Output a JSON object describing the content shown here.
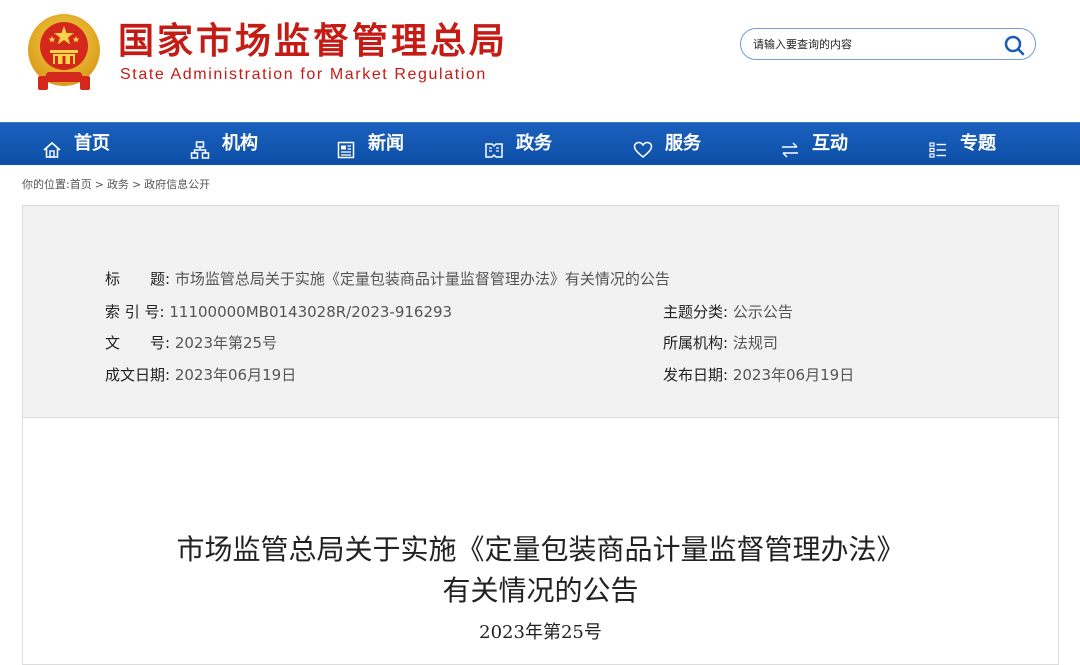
{
  "header": {
    "title_cn": "国家市场监督管理总局",
    "title_en": "State Administration for Market Regulation",
    "logo_icon": "national-emblem-icon",
    "brand_color": "#c41b14"
  },
  "search": {
    "placeholder": "请输入要查询的内容",
    "icon": "search-icon"
  },
  "nav": {
    "bg_color": "#1558b4",
    "items": [
      {
        "label": "首页",
        "icon": "home-icon"
      },
      {
        "label": "机构",
        "icon": "org-chart-icon"
      },
      {
        "label": "新闻",
        "icon": "news-icon"
      },
      {
        "label": "政务",
        "icon": "government-affairs-icon"
      },
      {
        "label": "服务",
        "icon": "heart-icon"
      },
      {
        "label": "互动",
        "icon": "exchange-icon"
      },
      {
        "label": "专题",
        "icon": "list-icon"
      }
    ]
  },
  "breadcrumb": {
    "prefix": "你的位置:",
    "items": [
      "首页",
      "政务",
      "政府信息公开"
    ],
    "separator": ">"
  },
  "info": {
    "title_label": "标　　题:",
    "title_value": "市场监管总局关于实施《定量包装商品计量监督管理办法》有关情况的公告",
    "index_label": "索 引 号:",
    "index_value": "11100000MB0143028R/2023-916293",
    "topic_label": "主题分类:",
    "topic_value": "公示公告",
    "docno_label": "文　　号:",
    "docno_value": "2023年第25号",
    "org_label": "所属机构:",
    "org_value": "法规司",
    "date_label": "成文日期:",
    "date_value": "2023年06月19日",
    "pubdate_label": "发布日期:",
    "pubdate_value": "2023年06月19日"
  },
  "article": {
    "title_line1": "市场监管总局关于实施《定量包装商品计量监督管理办法》",
    "title_line2": "有关情况的公告",
    "doc_number": "2023年第25号"
  }
}
